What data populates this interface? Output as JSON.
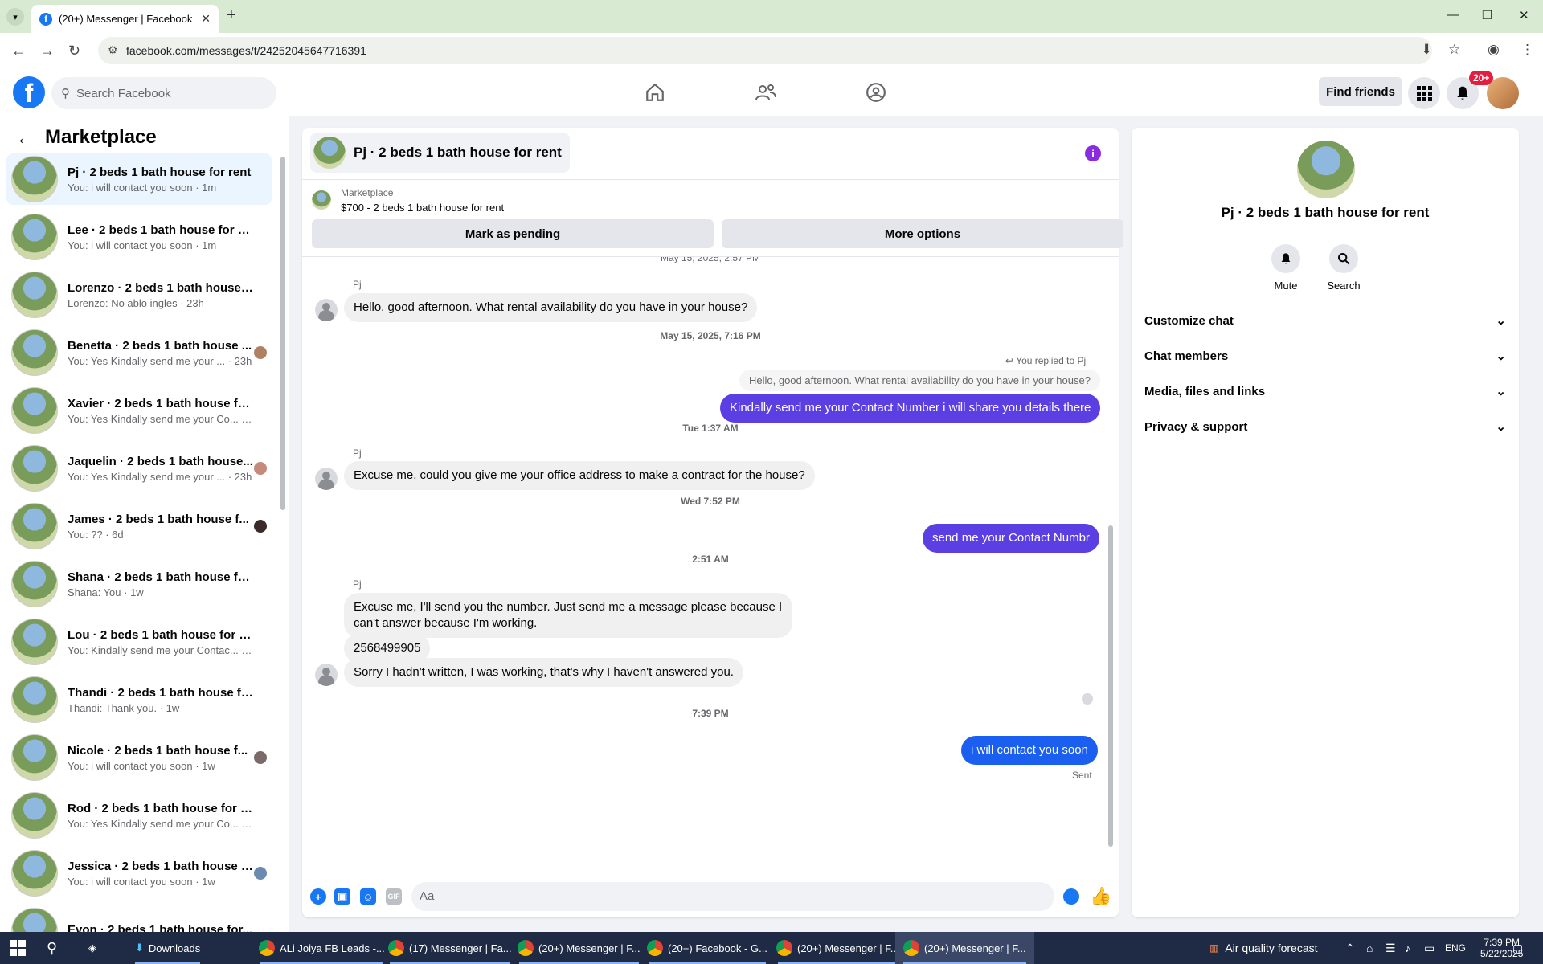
{
  "browser": {
    "tab_title": "(20+) Messenger | Facebook",
    "url": "facebook.com/messages/t/24252045647716391"
  },
  "fb": {
    "search_placeholder": "Search Facebook",
    "find_friends": "Find friends",
    "notif_badge": "20+"
  },
  "left": {
    "title": "Marketplace",
    "chats": [
      {
        "name": "Pj · 2 beds 1 bath house for rent",
        "preview": "You: i will contact you soon · 1m"
      },
      {
        "name": "Lee · 2 beds 1 bath house for rent",
        "preview": "You: i will contact you soon · 1m"
      },
      {
        "name": "Lorenzo · 2 beds 1 bath house fo...",
        "preview": "Lorenzo: No ablo ingles · 23h"
      },
      {
        "name": "Benetta · 2 beds 1 bath house ...",
        "preview": "You: Yes Kindally send me your ... · 23h"
      },
      {
        "name": "Xavier · 2 beds 1 bath house for ...",
        "preview": "You: Yes Kindally send me your Co... · 23h"
      },
      {
        "name": "Jaquelin · 2 beds 1 bath house...",
        "preview": "You: Yes Kindally send me your ... · 23h"
      },
      {
        "name": "James · 2 beds 1 bath house f...",
        "preview": "You: ?? · 6d"
      },
      {
        "name": "Shana · 2 beds 1 bath house for ...",
        "preview": "Shana: You · 1w"
      },
      {
        "name": "Lou · 2 beds 1 bath house for rent",
        "preview": "You: Kindally send me your Contac... · 1w"
      },
      {
        "name": "Thandi · 2 beds 1 bath house for...",
        "preview": "Thandi: Thank you. · 1w"
      },
      {
        "name": "Nicole · 2 beds 1 bath house f...",
        "preview": "You: i will contact you soon · 1w"
      },
      {
        "name": "Rod · 2 beds 1 bath house for rent",
        "preview": "You: Yes Kindally send me your Co... · 1w"
      },
      {
        "name": "Jessica · 2 beds 1 bath house f...",
        "preview": "You: i will contact you soon · 1w"
      },
      {
        "name": "Evon · 2 beds 1 bath house for...",
        "preview": ""
      }
    ]
  },
  "conv": {
    "header_title": "Pj · 2 beds 1 bath house for rent",
    "marketplace_label": "Marketplace",
    "listing": "$700 - 2 beds 1 bath house for rent",
    "mark_pending": "Mark as pending",
    "more_options": "More options",
    "cropped_ts": "May 15, 2025, 2:57 PM",
    "sender": "Pj",
    "msg1": "Hello, good afternoon. What rental availability do you have in your house?",
    "ts1": "May 15, 2025, 7:16 PM",
    "replied_note": "You replied to Pj",
    "reply_quote": "Hello, good afternoon. What rental availability do you have in your house?",
    "out1": "Kindally send me your Contact Number i will share you details there",
    "ts2": "Tue 1:37 AM",
    "msg2": "Excuse me, could you give me your office address to make a contract for the house?",
    "ts3": "Wed 7:52 PM",
    "out2": "send me your Contact Numbr",
    "ts4": "2:51 AM",
    "msg3": "Excuse me, I'll send you the number. Just send me a message please because I can't answer because I'm working.",
    "msg4": "2568499905",
    "msg5": "Sorry I hadn't written, I was working, that's why I haven't answered you.",
    "ts5": "7:39 PM",
    "out3": "i will contact you soon",
    "sent": "Sent",
    "composer_placeholder": "Aa"
  },
  "right": {
    "name": "Pj · 2 beds 1 bath house for rent",
    "mute": "Mute",
    "search": "Search",
    "rows": [
      "Customize chat",
      "Chat members",
      "Media, files and links",
      "Privacy & support"
    ]
  },
  "taskbar": {
    "items": [
      "Downloads",
      "ALi Joiya FB Leads -...",
      "(17) Messenger | Fa...",
      "(20+) Messenger | F...",
      "(20+) Facebook - G...",
      "(20+) Messenger | F...",
      "(20+) Messenger | F..."
    ],
    "weather": "Air quality forecast",
    "lang": "ENG",
    "time": "7:39 PM",
    "date": "5/22/2025"
  }
}
